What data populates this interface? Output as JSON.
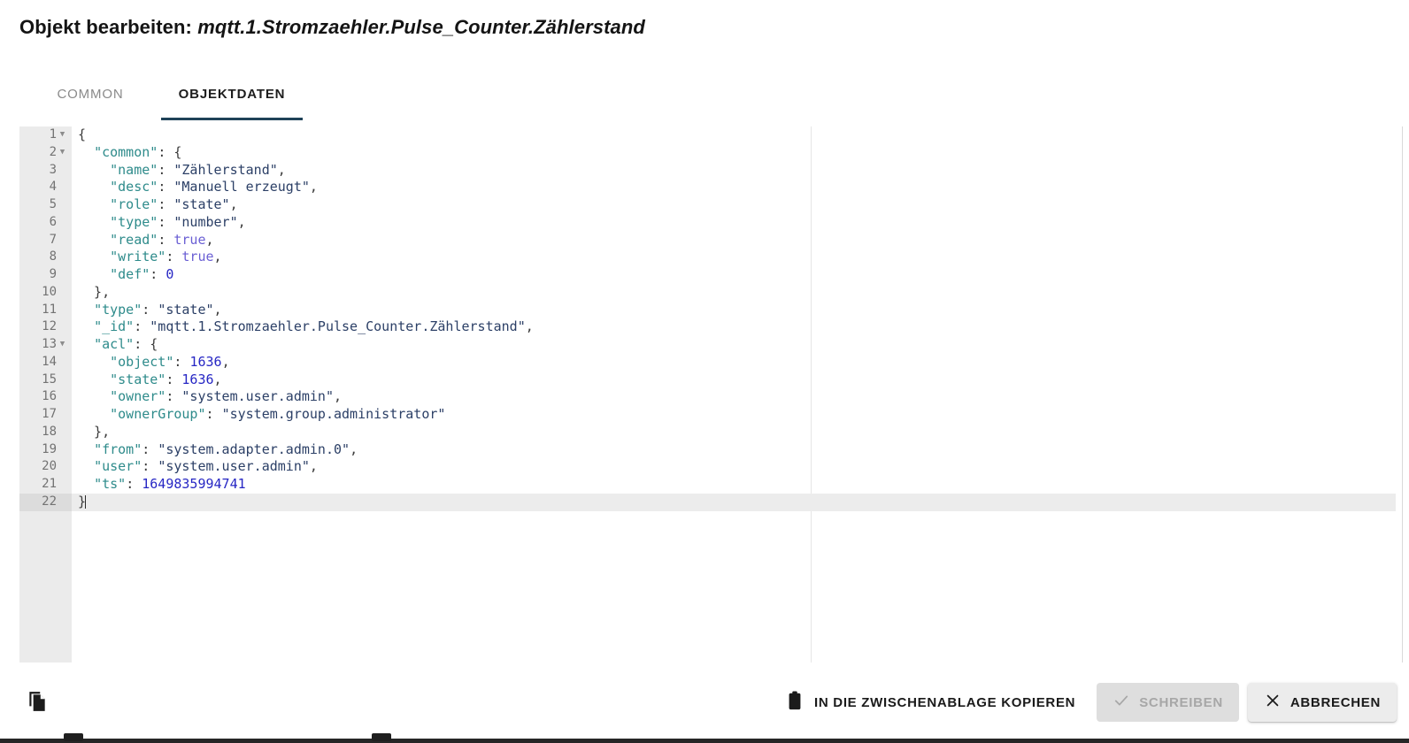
{
  "dialog": {
    "title_prefix": "Objekt bearbeiten:",
    "object_id": "mqtt.1.Stromzaehler.Pulse_Counter.Zählerstand"
  },
  "tabs": [
    {
      "label": "COMMON",
      "active": false
    },
    {
      "label": "OBJEKTDATEN",
      "active": true
    }
  ],
  "editor": {
    "language": "json",
    "total_lines": 22,
    "current_line": 22,
    "fold_lines": [
      1,
      2,
      13
    ],
    "raw_json": "{\n  \"common\": {\n    \"name\": \"Zählerstand\",\n    \"desc\": \"Manuell erzeugt\",\n    \"role\": \"state\",\n    \"type\": \"number\",\n    \"read\": true,\n    \"write\": true,\n    \"def\": 0\n  },\n  \"type\": \"state\",\n  \"_id\": \"mqtt.1.Stromzaehler.Pulse_Counter.Zählerstand\",\n  \"acl\": {\n    \"object\": 1636,\n    \"state\": 1636,\n    \"owner\": \"system.user.admin\",\n    \"ownerGroup\": \"system.group.administrator\"\n  },\n  \"from\": \"system.adapter.admin.0\",\n  \"user\": \"system.user.admin\",\n  \"ts\": 1649835994741\n}",
    "lines": [
      {
        "n": 1,
        "fold": true,
        "tokens": [
          {
            "t": "punct",
            "v": "{"
          }
        ]
      },
      {
        "n": 2,
        "fold": true,
        "tokens": [
          {
            "t": "punct",
            "v": "  "
          },
          {
            "t": "key",
            "v": "\"common\""
          },
          {
            "t": "punct",
            "v": ": {"
          }
        ]
      },
      {
        "n": 3,
        "fold": false,
        "tokens": [
          {
            "t": "punct",
            "v": "    "
          },
          {
            "t": "key",
            "v": "\"name\""
          },
          {
            "t": "punct",
            "v": ": "
          },
          {
            "t": "str",
            "v": "\"Zählerstand\""
          },
          {
            "t": "punct",
            "v": ","
          }
        ]
      },
      {
        "n": 4,
        "fold": false,
        "tokens": [
          {
            "t": "punct",
            "v": "    "
          },
          {
            "t": "key",
            "v": "\"desc\""
          },
          {
            "t": "punct",
            "v": ": "
          },
          {
            "t": "str",
            "v": "\"Manuell erzeugt\""
          },
          {
            "t": "punct",
            "v": ","
          }
        ]
      },
      {
        "n": 5,
        "fold": false,
        "tokens": [
          {
            "t": "punct",
            "v": "    "
          },
          {
            "t": "key",
            "v": "\"role\""
          },
          {
            "t": "punct",
            "v": ": "
          },
          {
            "t": "str",
            "v": "\"state\""
          },
          {
            "t": "punct",
            "v": ","
          }
        ]
      },
      {
        "n": 6,
        "fold": false,
        "tokens": [
          {
            "t": "punct",
            "v": "    "
          },
          {
            "t": "key",
            "v": "\"type\""
          },
          {
            "t": "punct",
            "v": ": "
          },
          {
            "t": "str",
            "v": "\"number\""
          },
          {
            "t": "punct",
            "v": ","
          }
        ]
      },
      {
        "n": 7,
        "fold": false,
        "tokens": [
          {
            "t": "punct",
            "v": "    "
          },
          {
            "t": "key",
            "v": "\"read\""
          },
          {
            "t": "punct",
            "v": ": "
          },
          {
            "t": "bool",
            "v": "true"
          },
          {
            "t": "punct",
            "v": ","
          }
        ]
      },
      {
        "n": 8,
        "fold": false,
        "tokens": [
          {
            "t": "punct",
            "v": "    "
          },
          {
            "t": "key",
            "v": "\"write\""
          },
          {
            "t": "punct",
            "v": ": "
          },
          {
            "t": "bool",
            "v": "true"
          },
          {
            "t": "punct",
            "v": ","
          }
        ]
      },
      {
        "n": 9,
        "fold": false,
        "tokens": [
          {
            "t": "punct",
            "v": "    "
          },
          {
            "t": "key",
            "v": "\"def\""
          },
          {
            "t": "punct",
            "v": ": "
          },
          {
            "t": "num",
            "v": "0"
          }
        ]
      },
      {
        "n": 10,
        "fold": false,
        "tokens": [
          {
            "t": "punct",
            "v": "  },"
          }
        ]
      },
      {
        "n": 11,
        "fold": false,
        "tokens": [
          {
            "t": "punct",
            "v": "  "
          },
          {
            "t": "key",
            "v": "\"type\""
          },
          {
            "t": "punct",
            "v": ": "
          },
          {
            "t": "str",
            "v": "\"state\""
          },
          {
            "t": "punct",
            "v": ","
          }
        ]
      },
      {
        "n": 12,
        "fold": false,
        "tokens": [
          {
            "t": "punct",
            "v": "  "
          },
          {
            "t": "key",
            "v": "\"_id\""
          },
          {
            "t": "punct",
            "v": ": "
          },
          {
            "t": "str",
            "v": "\"mqtt.1.Stromzaehler.Pulse_Counter.Zählerstand\""
          },
          {
            "t": "punct",
            "v": ","
          }
        ]
      },
      {
        "n": 13,
        "fold": true,
        "tokens": [
          {
            "t": "punct",
            "v": "  "
          },
          {
            "t": "key",
            "v": "\"acl\""
          },
          {
            "t": "punct",
            "v": ": {"
          }
        ]
      },
      {
        "n": 14,
        "fold": false,
        "tokens": [
          {
            "t": "punct",
            "v": "    "
          },
          {
            "t": "key",
            "v": "\"object\""
          },
          {
            "t": "punct",
            "v": ": "
          },
          {
            "t": "num",
            "v": "1636"
          },
          {
            "t": "punct",
            "v": ","
          }
        ]
      },
      {
        "n": 15,
        "fold": false,
        "tokens": [
          {
            "t": "punct",
            "v": "    "
          },
          {
            "t": "key",
            "v": "\"state\""
          },
          {
            "t": "punct",
            "v": ": "
          },
          {
            "t": "num",
            "v": "1636"
          },
          {
            "t": "punct",
            "v": ","
          }
        ]
      },
      {
        "n": 16,
        "fold": false,
        "tokens": [
          {
            "t": "punct",
            "v": "    "
          },
          {
            "t": "key",
            "v": "\"owner\""
          },
          {
            "t": "punct",
            "v": ": "
          },
          {
            "t": "str",
            "v": "\"system.user.admin\""
          },
          {
            "t": "punct",
            "v": ","
          }
        ]
      },
      {
        "n": 17,
        "fold": false,
        "tokens": [
          {
            "t": "punct",
            "v": "    "
          },
          {
            "t": "key",
            "v": "\"ownerGroup\""
          },
          {
            "t": "punct",
            "v": ": "
          },
          {
            "t": "str",
            "v": "\"system.group.administrator\""
          }
        ]
      },
      {
        "n": 18,
        "fold": false,
        "tokens": [
          {
            "t": "punct",
            "v": "  },"
          }
        ]
      },
      {
        "n": 19,
        "fold": false,
        "tokens": [
          {
            "t": "punct",
            "v": "  "
          },
          {
            "t": "key",
            "v": "\"from\""
          },
          {
            "t": "punct",
            "v": ": "
          },
          {
            "t": "str",
            "v": "\"system.adapter.admin.0\""
          },
          {
            "t": "punct",
            "v": ","
          }
        ]
      },
      {
        "n": 20,
        "fold": false,
        "tokens": [
          {
            "t": "punct",
            "v": "  "
          },
          {
            "t": "key",
            "v": "\"user\""
          },
          {
            "t": "punct",
            "v": ": "
          },
          {
            "t": "str",
            "v": "\"system.user.admin\""
          },
          {
            "t": "punct",
            "v": ","
          }
        ]
      },
      {
        "n": 21,
        "fold": false,
        "tokens": [
          {
            "t": "punct",
            "v": "  "
          },
          {
            "t": "key",
            "v": "\"ts\""
          },
          {
            "t": "punct",
            "v": ": "
          },
          {
            "t": "num",
            "v": "1649835994741"
          }
        ]
      },
      {
        "n": 22,
        "fold": false,
        "current": true,
        "caret": true,
        "tokens": [
          {
            "t": "punct",
            "v": "}"
          }
        ]
      }
    ]
  },
  "bottom_bar": {
    "duplicate_icon": "copy-pages-icon",
    "copy_button": {
      "label": "IN DIE ZWISCHENABLAGE KOPIEREN",
      "icon": "clipboard-icon"
    },
    "save_button": {
      "label": "SCHREIBEN",
      "icon": "check-icon",
      "disabled": true
    },
    "cancel_button": {
      "label": "ABBRECHEN",
      "icon": "close-icon",
      "disabled": false
    }
  },
  "colors": {
    "tab_active_underline": "#1f4258",
    "tab_active_text": "#1d1d1d",
    "tab_inactive_text": "#8a8a8a",
    "gutter_bg": "#ebebeb",
    "current_line_bg": "#ececec",
    "json_key": "#2e8b8b",
    "json_string": "#2b3f66",
    "json_number": "#2626c4",
    "json_boolean": "#6a5fd4",
    "disabled_button_bg": "#dedede",
    "disabled_button_text": "#a7a7a7"
  }
}
